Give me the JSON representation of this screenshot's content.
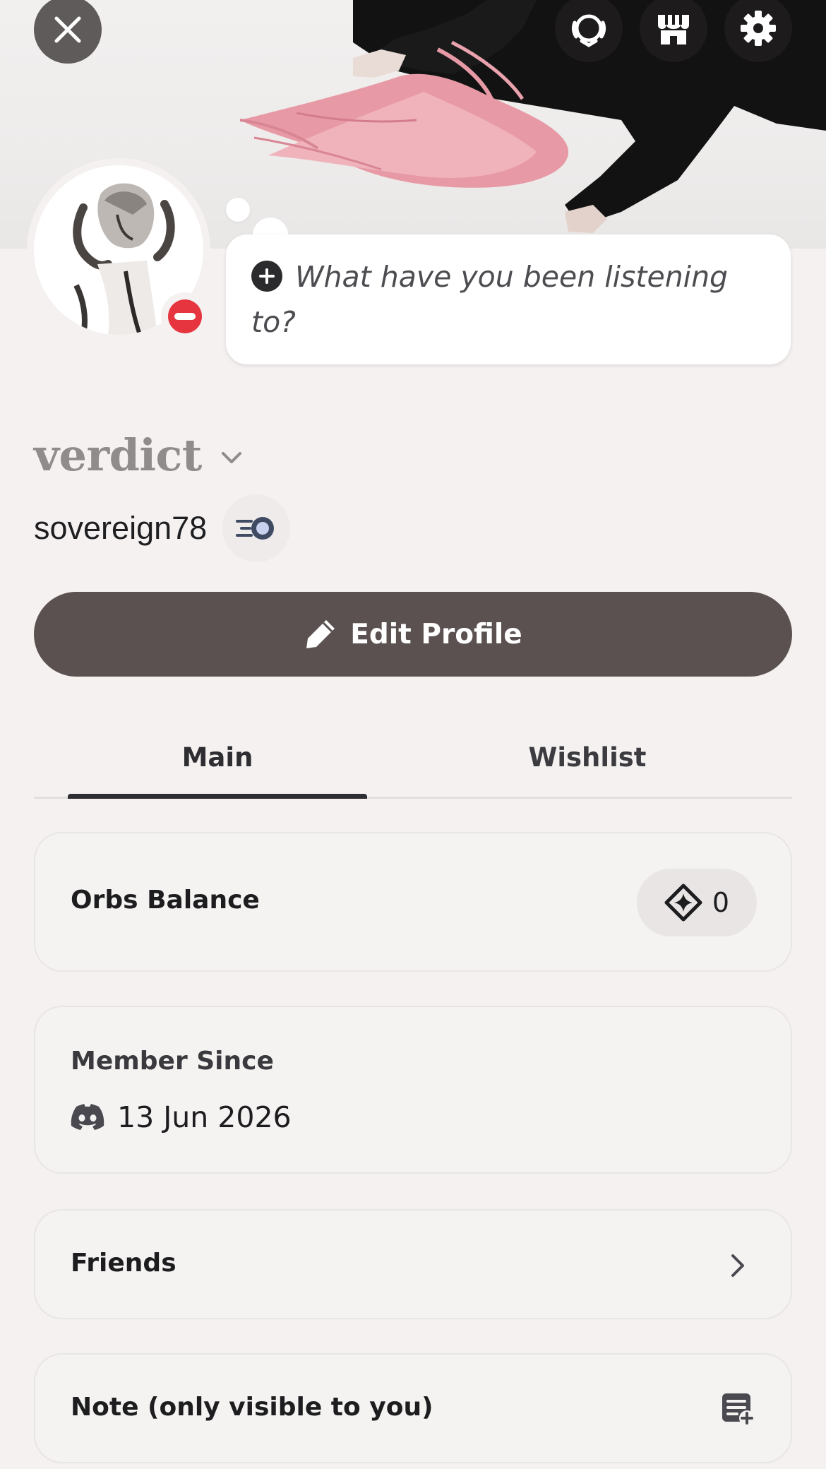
{
  "header": {
    "close_icon": "close-icon",
    "nitro_icon": "nitro-laurel-icon",
    "shop_icon": "shop-icon",
    "settings_icon": "gear-icon"
  },
  "profile": {
    "status": "do-not-disturb",
    "custom_status_placeholder": "What have you been listening to?",
    "display_name": "verdict",
    "username": "sovereign78",
    "badge_icon": "speed-badge-icon"
  },
  "actions": {
    "edit_profile_label": "Edit Profile"
  },
  "tabs": [
    {
      "label": "Main",
      "active": true
    },
    {
      "label": "Wishlist",
      "active": false
    }
  ],
  "cards": {
    "orbs": {
      "title": "Orbs Balance",
      "value": "0"
    },
    "member_since": {
      "title": "Member Since",
      "date": "13 Jun 2026"
    },
    "friends": {
      "title": "Friends"
    },
    "note": {
      "title": "Note (only visible to you)"
    }
  },
  "colors": {
    "background": "#f4f1f0",
    "edit_button": "#5a5150",
    "status_dnd": "#e6353f",
    "display_name": "#8f8c8b"
  }
}
